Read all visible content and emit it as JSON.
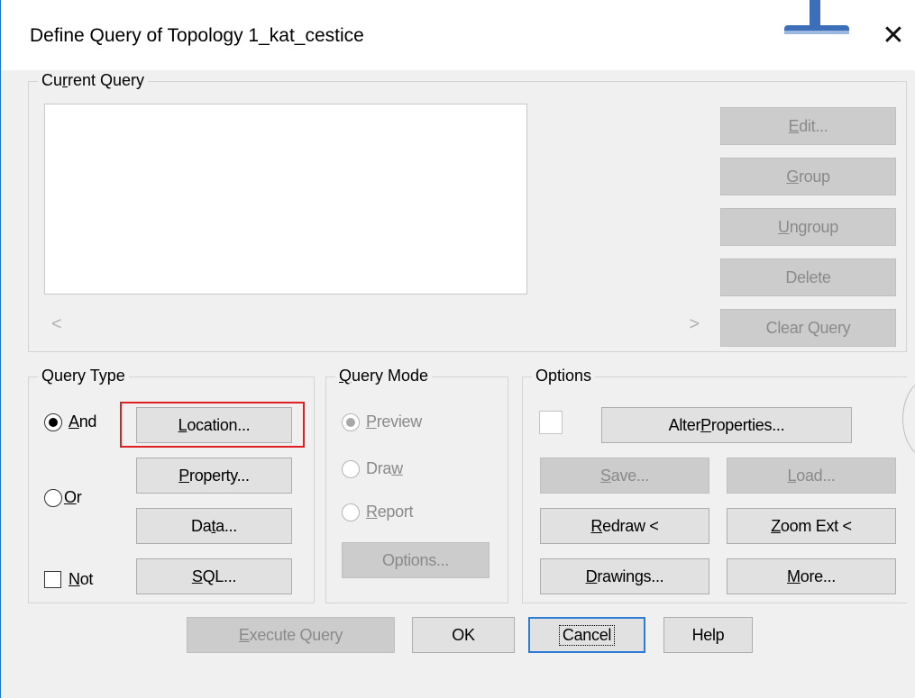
{
  "window": {
    "title": "Define Query of Topology 1_kat_cestice"
  },
  "current_query": {
    "label_pre": "Cu",
    "label_u": "r",
    "label_post": "rent Query",
    "buttons": {
      "edit": {
        "u": "E",
        "rest": "dit..."
      },
      "group": {
        "u": "G",
        "rest": "roup"
      },
      "ungroup": {
        "u": "U",
        "rest": "ngroup"
      },
      "delete": "Delete",
      "clear": "Clear Query"
    },
    "scroll_left": "<",
    "scroll_right": ">"
  },
  "query_type": {
    "label": "Query Type",
    "and": {
      "u": "A",
      "rest": "nd"
    },
    "or": {
      "u": "O",
      "rest": "r"
    },
    "not": {
      "u": "N",
      "rest": "ot"
    },
    "buttons": {
      "location": {
        "u": "L",
        "rest": "ocation..."
      },
      "property": {
        "u": "P",
        "rest": "roperty..."
      },
      "data": {
        "pre": "Da",
        "u": "t",
        "post": "a..."
      },
      "sql": {
        "u": "S",
        "rest": "QL..."
      }
    }
  },
  "query_mode": {
    "label_u": "Q",
    "label_rest": "uery Mode",
    "preview": {
      "u": "P",
      "rest": "review"
    },
    "draw": {
      "pre": "Dra",
      "u": "w"
    },
    "report": {
      "u": "R",
      "rest": "eport"
    },
    "options_btn": "Options..."
  },
  "options": {
    "label": "Options",
    "alter": {
      "pre": "Alter ",
      "u": "P",
      "post": "roperties..."
    },
    "save": {
      "u": "S",
      "rest": "ave..."
    },
    "load": {
      "u": "L",
      "rest": "oad..."
    },
    "redraw": {
      "u": "R",
      "rest": "edraw <"
    },
    "zoom": {
      "u": "Z",
      "rest": "oom Ext <"
    },
    "drawings": {
      "u": "D",
      "rest": "rawings..."
    },
    "more": {
      "u": "M",
      "rest": "ore..."
    }
  },
  "footer": {
    "execute": {
      "u": "E",
      "rest": "xecute Query"
    },
    "ok": "OK",
    "cancel": "Cancel",
    "help": "Help"
  }
}
